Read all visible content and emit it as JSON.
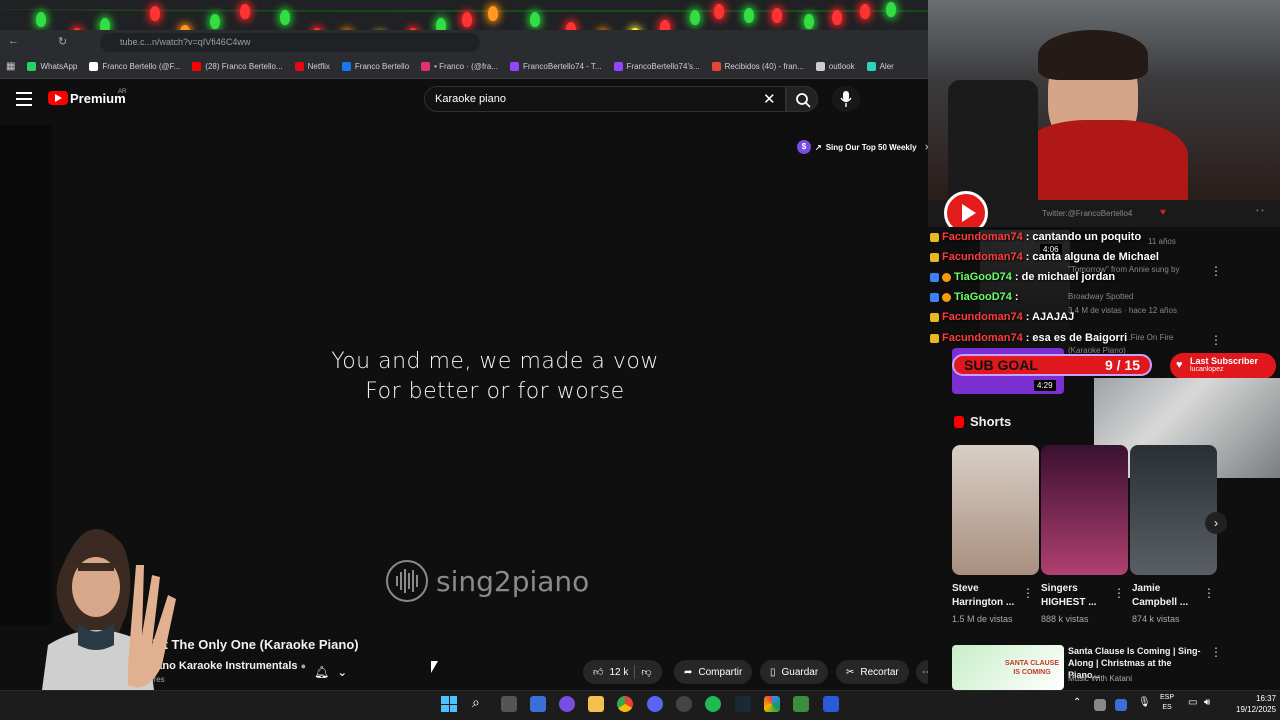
{
  "browser": {
    "url": "tube.c...n/watch?v=qIVfi46C4ww",
    "bookmarks": [
      {
        "label": "WhatsApp",
        "color": "#25d366"
      },
      {
        "label": "Franco Bertello (@F...",
        "color": "#ffffff"
      },
      {
        "label": "(28) Franco Bertello...",
        "color": "#ff0000"
      },
      {
        "label": "Netflix",
        "color": "#e50914"
      },
      {
        "label": "Franco Bertello",
        "color": "#1877f2"
      },
      {
        "label": "• Franco · (@fra...",
        "color": "#e1306c"
      },
      {
        "label": "FrancoBertello74 - T...",
        "color": "#9146ff"
      },
      {
        "label": "FrancoBertello74's...",
        "color": "#9146ff"
      },
      {
        "label": "Recibidos (40) - fran...",
        "color": "#ea4335"
      },
      {
        "label": "outlook",
        "color": "#cccccc"
      },
      {
        "label": "Aler",
        "color": "#2dd4bf"
      }
    ]
  },
  "youtube": {
    "brand": "Premium",
    "region": "AR",
    "search_value": "Karaoke piano",
    "promo": "Sing Our Top 50 Weekly",
    "lyrics": [
      "You and me, we made a vow",
      "For better or for worse"
    ],
    "watermark": "sing2piano",
    "video_title": "iot The Only One (Karaoke Piano)",
    "channel": "o | Piano Karaoke Instrumentals",
    "subscribers": "scriptores",
    "likes": "12 k",
    "share": "Compartir",
    "save": "Guardar",
    "clip": "Recortar"
  },
  "stream": {
    "twitter": "Twitter:@FrancoBertello4",
    "chat": [
      {
        "user": "Facundoman74",
        "msg": ": cantando un poquito",
        "user_color": "red"
      },
      {
        "user": "Facundoman74",
        "msg": ": canta alguna de Michael",
        "user_color": "red"
      },
      {
        "user": "TiaGooD74",
        "msg": ": de michael jordan",
        "user_color": "green"
      },
      {
        "user": "TiaGooD74",
        "msg": ":",
        "user_color": "green"
      },
      {
        "user": "Facundoman74",
        "msg": ": AJAJAJ",
        "user_color": "red"
      },
      {
        "user": "Facundoman74",
        "msg": ": esa es de Baigorri",
        "user_color": "red"
      }
    ],
    "rec_meta": [
      "11 años",
      "\"Tomorrow\" from Annie sung by",
      "Broadway Spotted",
      "3,4 M de vistas · hace 12 años",
      "...Fire On Fire",
      "(Karaoke Piano)"
    ],
    "duration_a": "4:06",
    "duration_b": "4:29",
    "sub_goal_label": "SUB GOAL",
    "sub_goal_count": "9 / 15",
    "last_sub_label": "Last Subscriber",
    "last_sub_name": "lucanlopez"
  },
  "shorts": {
    "title": "Shorts",
    "items": [
      {
        "title": "Steve Harrington ...",
        "views": "1.5 M de vistas"
      },
      {
        "title": "Singers HIGHEST ...",
        "views": "888 k vistas"
      },
      {
        "title": "Jamie Campbell ...",
        "views": "874 k vistas"
      }
    ]
  },
  "recommended": {
    "title": "Santa Clause Is Coming | Sing-Along | Christmas at the Piano...",
    "channel": "Music With Katani",
    "thumb_text": "SANTA CLAUSE IS COMING"
  },
  "taskbar": {
    "lang_top": "ESP",
    "lang_bottom": "ES",
    "time": "16:37",
    "date": "19/12/2025"
  }
}
